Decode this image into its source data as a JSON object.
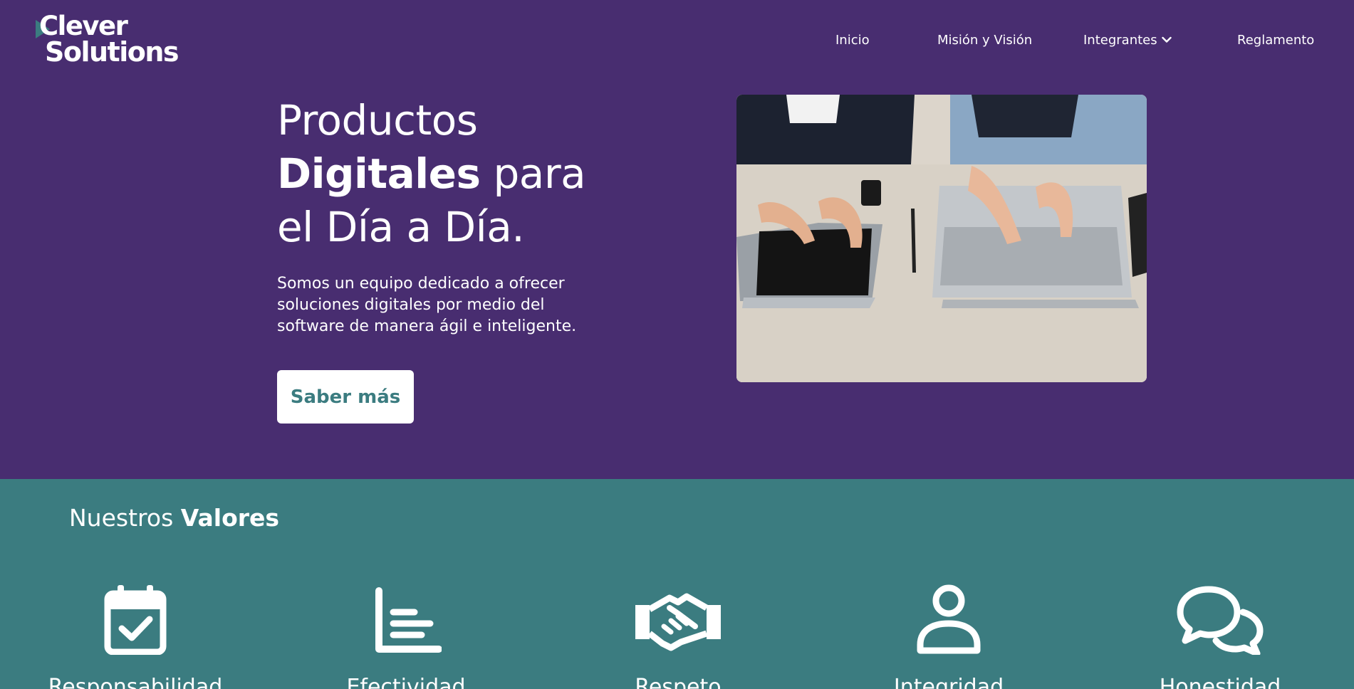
{
  "brand": {
    "line1": "Clever",
    "line2": "Solutions"
  },
  "nav": {
    "inicio": "Inicio",
    "mision": "Misión y Visión",
    "integrantes": "Integrantes",
    "reglamento": "Reglamento"
  },
  "hero": {
    "title_part1": "Productos",
    "title_bold": "Digitales",
    "title_part2": " para",
    "title_part3": "el Día a Día.",
    "description": "Somos un equipo dedicado a ofrecer soluciones digitales por medio del software de manera ágil e inteligente.",
    "button": "Saber más"
  },
  "values": {
    "title_normal": "Nuestros ",
    "title_bold": "Valores",
    "items": [
      {
        "label": "Responsabilidad",
        "icon": "calendar-check-icon"
      },
      {
        "label": "Efectividad",
        "icon": "bar-chart-icon"
      },
      {
        "label": "Respeto",
        "icon": "handshake-icon"
      },
      {
        "label": "Integridad",
        "icon": "user-icon"
      },
      {
        "label": "Honestidad",
        "icon": "chat-bubbles-icon"
      }
    ]
  },
  "colors": {
    "hero_bg": "#482d70",
    "values_bg": "#3b7c80",
    "button_text": "#3b7c80"
  }
}
